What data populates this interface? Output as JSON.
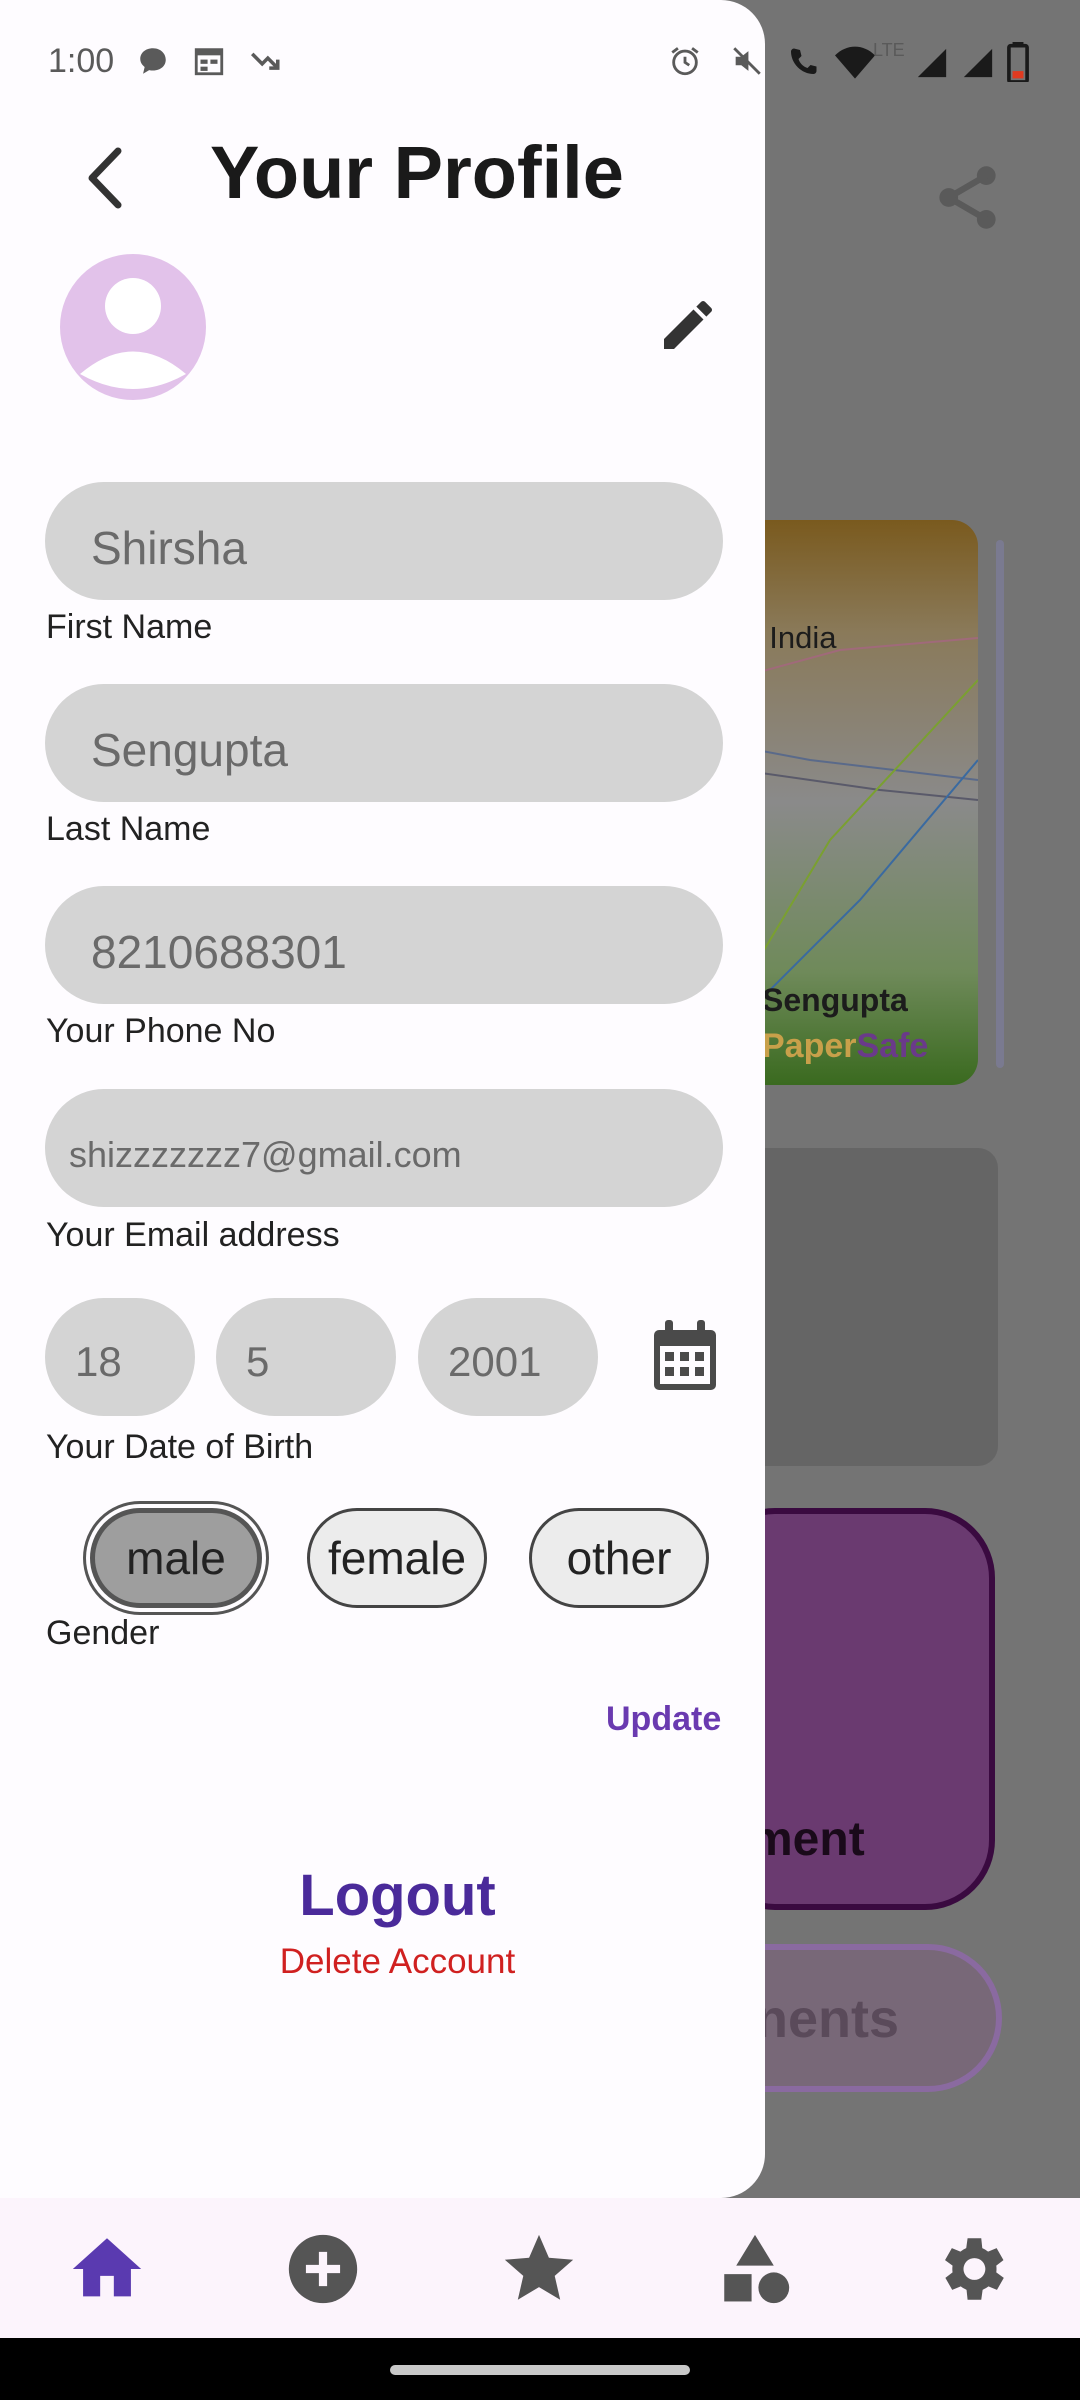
{
  "status_bar": {
    "time": "1:00",
    "network": "LTE"
  },
  "profile": {
    "title": "Your Profile",
    "first_name": {
      "value": "Shirsha",
      "label": "First Name"
    },
    "last_name": {
      "value": "Sengupta",
      "label": "Last Name"
    },
    "phone": {
      "value": "8210688301",
      "label": "Your Phone No"
    },
    "email": {
      "value": "shizzzzzzz7@gmail.com",
      "label": "Your Email address"
    },
    "dob": {
      "day": "18",
      "month": "5",
      "year": "2001",
      "label": "Your Date of Birth"
    },
    "gender": {
      "options": [
        "male",
        "female",
        "other"
      ],
      "selected": "male",
      "label": "Gender"
    },
    "update_label": "Update",
    "logout_label": "Logout",
    "delete_label": "Delete Account"
  },
  "background": {
    "doc_text": "f India",
    "doc_name": "Sengupta",
    "brand_part1": "Paper",
    "brand_part2": "Safe",
    "purple_button_label": "ment",
    "outline_button_label": "nents"
  },
  "bottom_nav": {
    "items": [
      "home-icon",
      "add-circle-icon",
      "star-icon",
      "category-icon",
      "settings-icon"
    ],
    "active": "home-icon"
  },
  "colors": {
    "accent": "#4a2a9a",
    "update": "#6a3ab0",
    "danger": "#d02020",
    "avatar": "#e2c2ea",
    "field_bg": "#d4d4d4",
    "scrim": "#747474"
  }
}
